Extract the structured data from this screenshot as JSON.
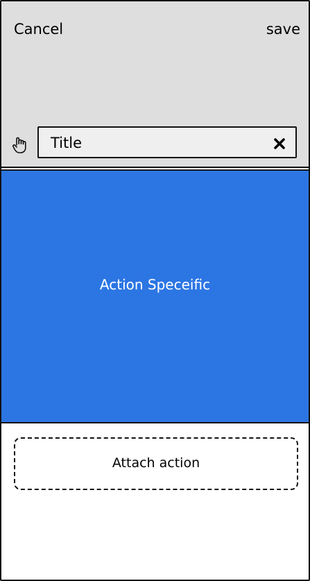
{
  "header": {
    "cancel_label": "Cancel",
    "save_label": "save",
    "title_value": "Title",
    "background": "#dedede"
  },
  "icons": {
    "grab": "hand-icon",
    "clear": "close-icon"
  },
  "action_panel": {
    "label": "Action Speceific",
    "color": "#2c76e4"
  },
  "attach": {
    "label": "Attach action"
  }
}
